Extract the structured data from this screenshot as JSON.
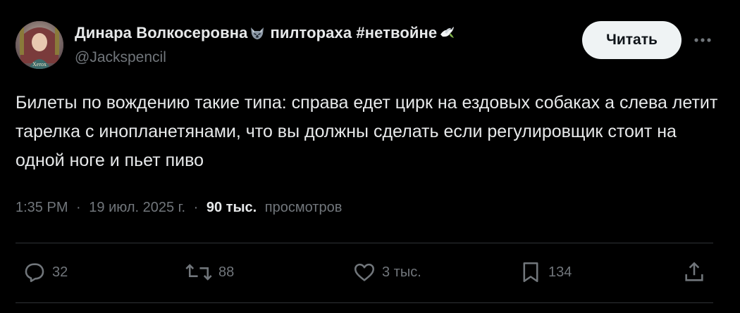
{
  "author": {
    "display_name": "Динара Волкосеровна",
    "name_suffix": "пилтораха #нетвойне",
    "handle": "@Jackspencil",
    "avatar_text": "Xerox"
  },
  "follow_label": "Читать",
  "tweet_text": "Билеты по вождению такие типа: справа едет цирк на ездовых собаках а слева летит тарелка с инопланетянами, что вы должны сделать если регулировщик стоит на одной ноге и пьет пиво",
  "meta": {
    "time": "1:35 PM",
    "sep1": "·",
    "date": "19 июл. 2025 г.",
    "sep2": "·",
    "views_count": "90 тыс.",
    "views_label": "просмотров"
  },
  "actions": {
    "replies": "32",
    "reposts": "88",
    "likes": "3 тыс.",
    "bookmarks": "134"
  },
  "colors": {
    "background": "#000000",
    "text_primary": "#e7e9ea",
    "text_secondary": "#71767b",
    "divider": "#2f3336",
    "button_bg": "#eff3f4"
  },
  "icons": [
    "wolf-emoji-icon",
    "dove-emoji-icon",
    "more-icon",
    "reply-icon",
    "repost-icon",
    "like-icon",
    "bookmark-icon",
    "share-icon"
  ]
}
